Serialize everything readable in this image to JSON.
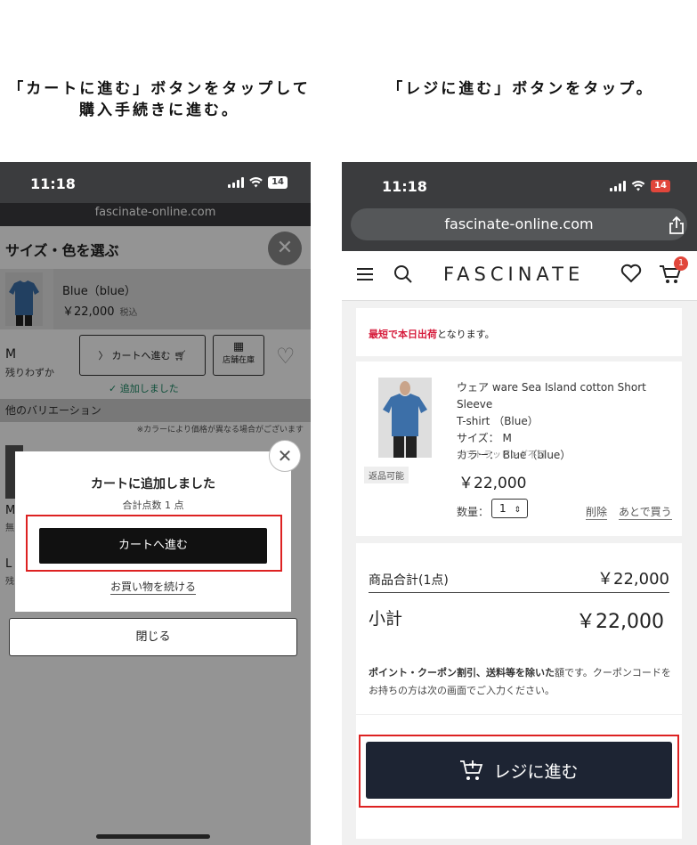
{
  "captions": {
    "left_line1": "「カートに進む」ボタンをタップして",
    "left_line2": "購入手続きに進む。",
    "right": "「レジに進む」ボタンをタップ。"
  },
  "left_phone": {
    "status": {
      "time": "11:18",
      "battery": "14"
    },
    "url": "fascinate-online.com",
    "sheet_title": "サイズ・色を選ぶ",
    "product": {
      "color": "Blue（blue）",
      "price": "￥22,000",
      "tax": "税込"
    },
    "size_row": {
      "size": "M",
      "stock": "残りわずか",
      "cart_button": "カートへ進む",
      "store_button": "店舗在庫",
      "added": "追加しました"
    },
    "variation_header": "他のバリエーション",
    "variation_note": "※カラーにより価格が異なる場合がございます",
    "rows": [
      {
        "label": "M",
        "sub": "無"
      },
      {
        "label": "L",
        "sub": "残"
      }
    ],
    "close_button": "閉じる",
    "modal": {
      "title": "カートに追加しました",
      "count": "合計点数 1 点",
      "proceed_button": "カートへ進む",
      "continue_link": "お買い物を続ける"
    },
    "colors": {
      "highlight": "#dd2222",
      "overlay": "#000000"
    }
  },
  "right_phone": {
    "status": {
      "time": "11:18",
      "battery": "14"
    },
    "url": "fascinate-online.com",
    "logo": "FASCINATE",
    "cart_count": "1",
    "shipping": {
      "highlight": "最短で本日出荷",
      "rest": "となります。"
    },
    "item": {
      "name_line1": "ウェア ware Sea Island cotton Short Sleeve",
      "name_line2": "T-shirt （Blue）",
      "size": "サイズ： M",
      "color": "カラー： Blue（blue）",
      "wrapping": "ギフトラッピング不可",
      "returnable": "返品可能",
      "price": "￥22,000",
      "qty_label": "数量：",
      "qty_value": "1",
      "delete": "削除",
      "save_later": "あとで買う"
    },
    "summary": {
      "subtotal_label": "商品合計(1点)",
      "subtotal_value": "￥22,000",
      "total_label": "小計",
      "total_value": "￥22,000",
      "note_bold": "ポイント・クーポン割引、送料等を除いた",
      "note_rest": "額です。クーポンコードをお持ちの方は次の画面でご入力ください。"
    },
    "checkout_button": "レジに進む",
    "colors": {
      "checkout_bg": "#1d2433",
      "highlight": "#dd2222",
      "shipping_red": "#d61c3c",
      "badge": "#e1463b"
    }
  }
}
